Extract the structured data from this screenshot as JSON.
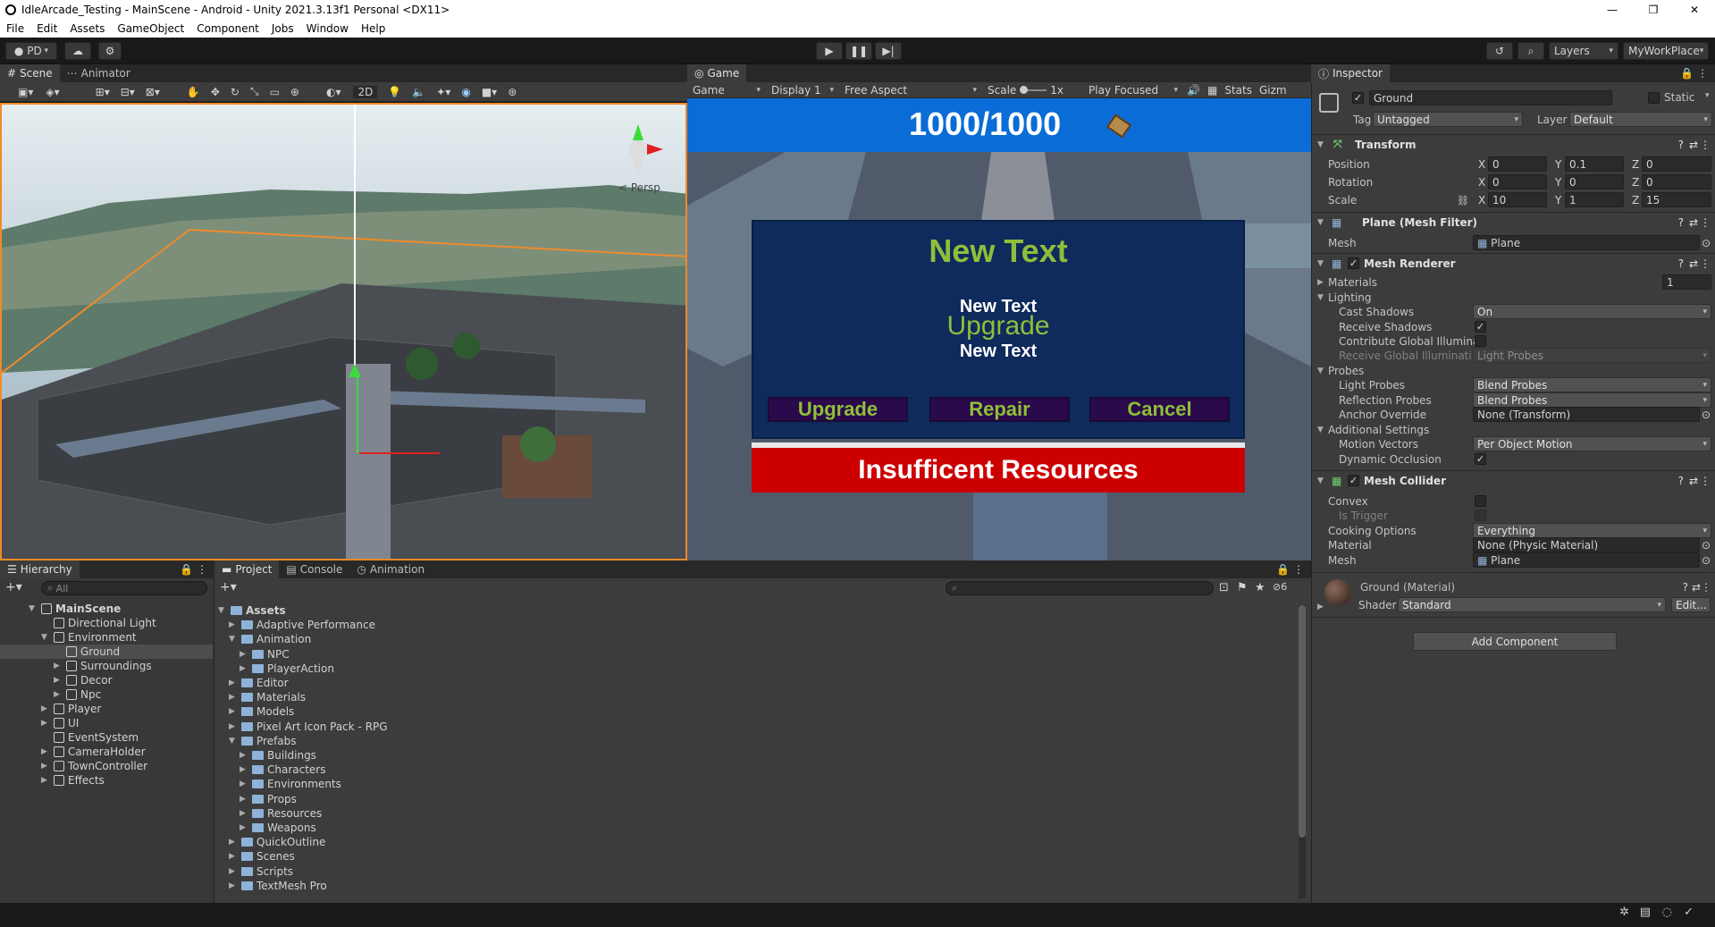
{
  "window": {
    "title": "IdleArcade_Testing - MainScene - Android - Unity 2021.3.13f1 Personal <DX11>",
    "controls": [
      "—",
      "❐",
      "✕"
    ]
  },
  "menu": [
    "File",
    "Edit",
    "Assets",
    "GameObject",
    "Component",
    "Jobs",
    "Window",
    "Help"
  ],
  "toolbar": {
    "account": "PD",
    "layers": "Layers",
    "layout": "MyWorkPlace"
  },
  "scene_panel": {
    "tabs": [
      "Scene",
      "Animator"
    ],
    "mode_2d": "2D",
    "persp": "Persp"
  },
  "game_panel": {
    "tab": "Game",
    "display_mode": "Game",
    "display": "Display 1",
    "aspect": "Free Aspect",
    "scale_label": "Scale",
    "scale_value": "1x",
    "play_focused": "Play Focused",
    "stats": "Stats",
    "gizmos": "Gizmos",
    "hud_counter": "1000/1000",
    "popup_title": "New Text",
    "popup_line1": "New Text",
    "popup_line2": "Upgrade",
    "popup_line3": "New Text",
    "btn_upgrade": "Upgrade",
    "btn_repair": "Repair",
    "btn_cancel": "Cancel",
    "warning": "Insufficent Resources"
  },
  "hierarchy": {
    "tab": "Hierarchy",
    "search_placeholder": "All",
    "items": [
      {
        "label": "MainScene",
        "depth": 0,
        "bold": true
      },
      {
        "label": "Directional Light",
        "depth": 1
      },
      {
        "label": "Environment",
        "depth": 1
      },
      {
        "label": "Ground",
        "depth": 2,
        "selected": true
      },
      {
        "label": "Surroundings",
        "depth": 2
      },
      {
        "label": "Decor",
        "depth": 2
      },
      {
        "label": "Npc",
        "depth": 2
      },
      {
        "label": "Player",
        "depth": 1
      },
      {
        "label": "UI",
        "depth": 1
      },
      {
        "label": "EventSystem",
        "depth": 1
      },
      {
        "label": "CameraHolder",
        "depth": 1
      },
      {
        "label": "TownController",
        "depth": 1
      },
      {
        "label": "Effects",
        "depth": 1
      }
    ]
  },
  "project": {
    "tabs": [
      "Project",
      "Console",
      "Animation"
    ],
    "hidden_count": "6",
    "tree": [
      {
        "label": "Assets",
        "depth": 0,
        "bold": true
      },
      {
        "label": "Adaptive Performance",
        "depth": 1
      },
      {
        "label": "Animation",
        "depth": 1
      },
      {
        "label": "NPC",
        "depth": 2
      },
      {
        "label": "PlayerAction",
        "depth": 2
      },
      {
        "label": "Editor",
        "depth": 1
      },
      {
        "label": "Materials",
        "depth": 1
      },
      {
        "label": "Models",
        "depth": 1
      },
      {
        "label": "Pixel Art Icon Pack - RPG",
        "depth": 1
      },
      {
        "label": "Prefabs",
        "depth": 1
      },
      {
        "label": "Buildings",
        "depth": 2
      },
      {
        "label": "Characters",
        "depth": 2
      },
      {
        "label": "Environments",
        "depth": 2
      },
      {
        "label": "Props",
        "depth": 2
      },
      {
        "label": "Resources",
        "depth": 2
      },
      {
        "label": "Weapons",
        "depth": 2
      },
      {
        "label": "QuickOutline",
        "depth": 1
      },
      {
        "label": "Scenes",
        "depth": 1
      },
      {
        "label": "Scripts",
        "depth": 1
      },
      {
        "label": "TextMesh Pro",
        "depth": 1
      }
    ]
  },
  "inspector": {
    "tab": "Inspector",
    "object_name": "Ground",
    "static_label": "Static",
    "tag_label": "Tag",
    "tag_value": "Untagged",
    "layer_label": "Layer",
    "layer_value": "Default",
    "transform": {
      "title": "Transform",
      "position": {
        "label": "Position",
        "x": "0",
        "y": "0.1",
        "z": "0"
      },
      "rotation": {
        "label": "Rotation",
        "x": "0",
        "y": "0",
        "z": "0"
      },
      "scale": {
        "label": "Scale",
        "x": "10",
        "y": "1",
        "z": "15"
      }
    },
    "mesh_filter": {
      "title": "Plane (Mesh Filter)",
      "mesh_label": "Mesh",
      "mesh_value": "Plane"
    },
    "mesh_renderer": {
      "title": "Mesh Renderer",
      "materials_label": "Materials",
      "materials_count": "1",
      "lighting": "Lighting",
      "cast_shadows_label": "Cast Shadows",
      "cast_shadows_value": "On",
      "receive_shadows_label": "Receive Shadows",
      "contribute_gi_label": "Contribute Global Illuminat",
      "receive_gi_label": "Receive Global Illuminatior",
      "receive_gi_value": "Light Probes",
      "probes": "Probes",
      "light_probes_label": "Light Probes",
      "light_probes_value": "Blend Probes",
      "reflection_probes_label": "Reflection Probes",
      "reflection_probes_value": "Blend Probes",
      "anchor_label": "Anchor Override",
      "anchor_value": "None (Transform)",
      "additional": "Additional Settings",
      "motion_label": "Motion Vectors",
      "motion_value": "Per Object Motion",
      "occlusion_label": "Dynamic Occlusion"
    },
    "mesh_collider": {
      "title": "Mesh Collider",
      "convex_label": "Convex",
      "trigger_label": "Is Trigger",
      "cooking_label": "Cooking Options",
      "cooking_value": "Everything",
      "material_label": "Material",
      "material_value": "None (Physic Material)",
      "mesh_label": "Mesh",
      "mesh_value": "Plane"
    },
    "material": {
      "title": "Ground (Material)",
      "shader_label": "Shader",
      "shader_value": "Standard",
      "edit": "Edit..."
    },
    "add_component": "Add Component"
  },
  "colors": {
    "accent_green": "#8fbf3a",
    "hud_blue": "#0a6cd6",
    "warning_red": "#cc0000",
    "popup_navy": "#0f2a5c"
  }
}
